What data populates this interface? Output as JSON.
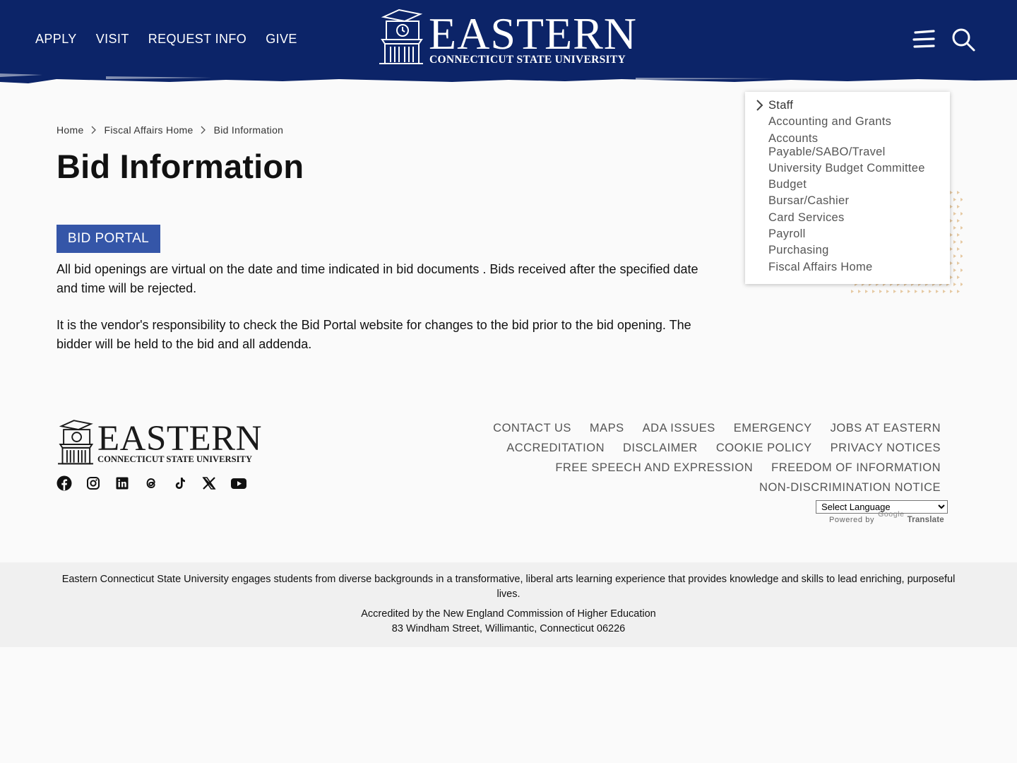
{
  "header": {
    "nav": [
      "APPLY",
      "VISIT",
      "REQUEST INFO",
      "GIVE"
    ],
    "logo_name": "EASTERN",
    "logo_sub": "CONNECTICUT STATE UNIVERSITY",
    "menu_icon": "hamburger-icon",
    "search_icon": "search-icon",
    "bg_color": "#0c2468"
  },
  "sidemenu": {
    "items": [
      "Staff",
      "Accounting and Grants",
      "Accounts Payable/SABO/Travel",
      "University Budget Committee",
      "Budget",
      "Bursar/Cashier",
      "Card Services",
      "Payroll",
      "Purchasing",
      "Fiscal Affairs Home"
    ]
  },
  "breadcrumb": [
    "Home",
    "Fiscal Affairs Home",
    "Bid Information"
  ],
  "main": {
    "title": "Bid Information",
    "bid_button": "BID PORTAL",
    "para1": "All bid openings are virtual on the date and time indicated in bid documents . Bids received after the specified date and time will be rejected.",
    "para2": "It is the vendor's responsibility to check the Bid Portal website for changes to the bid prior to the bid opening. The bidder will be held to the bid and all addenda.",
    "accent_color": "#3556a8"
  },
  "footer": {
    "logo_name": "EASTERN",
    "logo_sub": "CONNECTICUT STATE UNIVERSITY",
    "social": [
      "facebook-icon",
      "instagram-icon",
      "linkedin-icon",
      "threads-icon",
      "tiktok-icon",
      "x-icon",
      "youtube-icon"
    ],
    "links": [
      [
        "CONTACT US",
        "MAPS",
        "ADA ISSUES",
        "EMERGENCY",
        "JOBS AT EASTERN"
      ],
      [
        "ACCREDITATION",
        "DISCLAIMER",
        "COOKIE POLICY",
        "PRIVACY NOTICES"
      ],
      [
        "FREE SPEECH AND EXPRESSION",
        "FREEDOM OF INFORMATION"
      ],
      [
        "NON-DISCRIMINATION NOTICE"
      ]
    ],
    "language_select": "Select Language",
    "powered_by": "Powered by",
    "google": "Google",
    "translate": "Translate"
  },
  "mission": {
    "statement": "Eastern Connecticut State University engages students from diverse backgrounds in a transformative, liberal arts learning experience that provides knowledge and skills to lead enriching, purposeful lives.",
    "accreditation": "Accredited by the New England Commission of Higher Education",
    "address": "83 Windham Street, Willimantic, Connecticut 06226"
  }
}
